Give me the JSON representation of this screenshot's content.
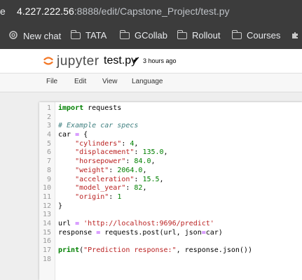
{
  "browser": {
    "edge_glyph": "e",
    "url_host": "4.227.222.56",
    "url_path": ":8888/edit/Capstone_Project/test.py",
    "bookmarks": [
      {
        "label": "New chat",
        "icon": "openai-icon"
      },
      {
        "label": "TATA",
        "icon": "folder-icon"
      },
      {
        "label": "GCollab",
        "icon": "folder-icon"
      },
      {
        "label": "Rollout",
        "icon": "folder-icon"
      },
      {
        "label": "Courses",
        "icon": "folder-icon"
      }
    ],
    "overflow_icon": "puzzle-icon"
  },
  "jupyter": {
    "brand": "jupyter",
    "filename": "test.py",
    "save_status": "3 hours ago",
    "menu": [
      "File",
      "Edit",
      "View",
      "Language"
    ]
  },
  "colors": {
    "keyword": "#008000",
    "string": "#ba2121",
    "comment": "#408080",
    "number": "#008000",
    "operator": "#aa22ff",
    "logo_orange": "#f37726"
  },
  "editor": {
    "lines": [
      {
        "n": "1",
        "tokens": [
          {
            "t": "import",
            "c": "kw"
          },
          {
            "t": " requests",
            "c": "pl"
          }
        ]
      },
      {
        "n": "2",
        "tokens": []
      },
      {
        "n": "3",
        "tokens": [
          {
            "t": "# Example car specs",
            "c": "cm"
          }
        ]
      },
      {
        "n": "4",
        "tokens": [
          {
            "t": "car ",
            "c": "pl"
          },
          {
            "t": "=",
            "c": "op"
          },
          {
            "t": " {",
            "c": "pl"
          }
        ]
      },
      {
        "n": "5",
        "tokens": [
          {
            "t": "    ",
            "c": "pl"
          },
          {
            "t": "\"cylinders\"",
            "c": "str"
          },
          {
            "t": ": ",
            "c": "pl"
          },
          {
            "t": "4",
            "c": "num"
          },
          {
            "t": ",",
            "c": "pl"
          }
        ]
      },
      {
        "n": "6",
        "tokens": [
          {
            "t": "    ",
            "c": "pl"
          },
          {
            "t": "\"displacement\"",
            "c": "str"
          },
          {
            "t": ": ",
            "c": "pl"
          },
          {
            "t": "135.0",
            "c": "num"
          },
          {
            "t": ",",
            "c": "pl"
          }
        ]
      },
      {
        "n": "7",
        "tokens": [
          {
            "t": "    ",
            "c": "pl"
          },
          {
            "t": "\"horsepower\"",
            "c": "str"
          },
          {
            "t": ": ",
            "c": "pl"
          },
          {
            "t": "84.0",
            "c": "num"
          },
          {
            "t": ",",
            "c": "pl"
          }
        ]
      },
      {
        "n": "8",
        "tokens": [
          {
            "t": "    ",
            "c": "pl"
          },
          {
            "t": "\"weight\"",
            "c": "str"
          },
          {
            "t": ": ",
            "c": "pl"
          },
          {
            "t": "2064.0",
            "c": "num"
          },
          {
            "t": ",",
            "c": "pl"
          }
        ]
      },
      {
        "n": "9",
        "tokens": [
          {
            "t": "    ",
            "c": "pl"
          },
          {
            "t": "\"acceleration\"",
            "c": "str"
          },
          {
            "t": ": ",
            "c": "pl"
          },
          {
            "t": "15.5",
            "c": "num"
          },
          {
            "t": ",",
            "c": "pl"
          }
        ]
      },
      {
        "n": "10",
        "tokens": [
          {
            "t": "    ",
            "c": "pl"
          },
          {
            "t": "\"model_year\"",
            "c": "str"
          },
          {
            "t": ": ",
            "c": "pl"
          },
          {
            "t": "82",
            "c": "num"
          },
          {
            "t": ",",
            "c": "pl"
          }
        ]
      },
      {
        "n": "11",
        "tokens": [
          {
            "t": "    ",
            "c": "pl"
          },
          {
            "t": "\"origin\"",
            "c": "str"
          },
          {
            "t": ": ",
            "c": "pl"
          },
          {
            "t": "1",
            "c": "num"
          }
        ]
      },
      {
        "n": "12",
        "tokens": [
          {
            "t": "}",
            "c": "pl"
          }
        ]
      },
      {
        "n": "13",
        "tokens": []
      },
      {
        "n": "14",
        "tokens": [
          {
            "t": "url ",
            "c": "pl"
          },
          {
            "t": "=",
            "c": "op"
          },
          {
            "t": " ",
            "c": "pl"
          },
          {
            "t": "'http://localhost:9696/predict'",
            "c": "str"
          }
        ]
      },
      {
        "n": "15",
        "tokens": [
          {
            "t": "response ",
            "c": "pl"
          },
          {
            "t": "=",
            "c": "op"
          },
          {
            "t": " requests.post(url, json",
            "c": "pl"
          },
          {
            "t": "=",
            "c": "op"
          },
          {
            "t": "car)",
            "c": "pl"
          }
        ]
      },
      {
        "n": "16",
        "tokens": []
      },
      {
        "n": "17",
        "tokens": [
          {
            "t": "print",
            "c": "kw"
          },
          {
            "t": "(",
            "c": "pl"
          },
          {
            "t": "\"Prediction response:\"",
            "c": "str"
          },
          {
            "t": ", response.json())",
            "c": "pl"
          }
        ]
      },
      {
        "n": "18",
        "tokens": []
      }
    ]
  }
}
